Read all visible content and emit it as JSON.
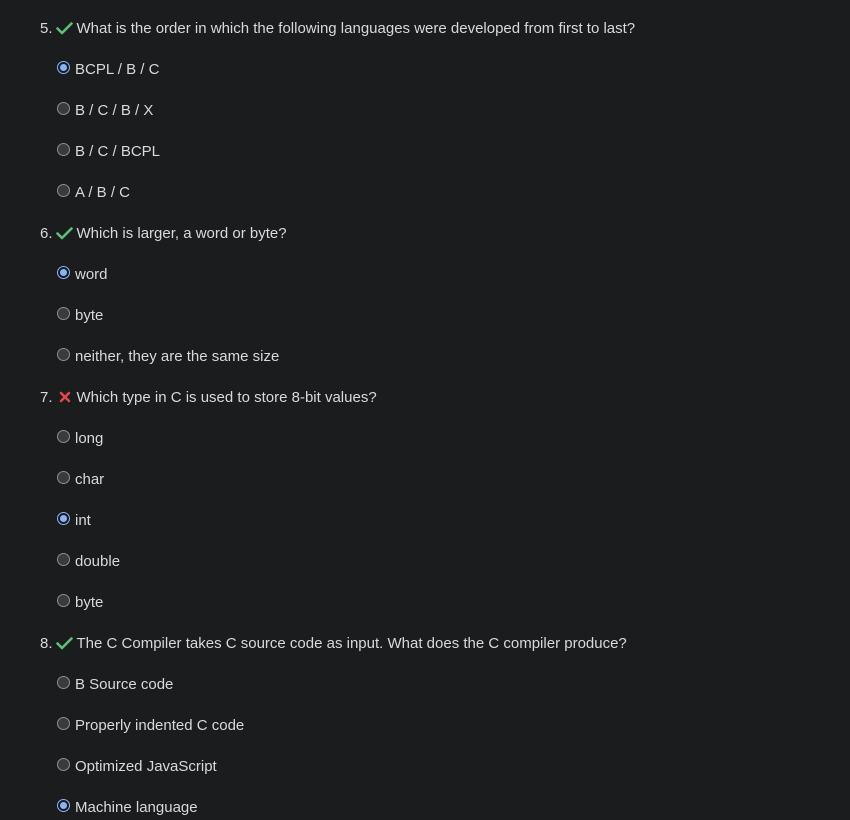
{
  "questions": [
    {
      "number": "5.",
      "status": "correct",
      "text": "What is the order in which the following languages were developed from first to last?",
      "options": [
        {
          "label": "BCPL / B / C",
          "selected": true
        },
        {
          "label": "B / C / B / X",
          "selected": false
        },
        {
          "label": "B / C / BCPL",
          "selected": false
        },
        {
          "label": "A / B / C",
          "selected": false
        }
      ]
    },
    {
      "number": "6.",
      "status": "correct",
      "text": "Which is larger, a word or byte?",
      "options": [
        {
          "label": "word",
          "selected": true
        },
        {
          "label": "byte",
          "selected": false
        },
        {
          "label": "neither, they are the same size",
          "selected": false
        }
      ]
    },
    {
      "number": "7.",
      "status": "incorrect",
      "text": "Which type in C is used to store 8-bit values?",
      "options": [
        {
          "label": "long",
          "selected": false
        },
        {
          "label": "char",
          "selected": false
        },
        {
          "label": "int",
          "selected": true
        },
        {
          "label": "double",
          "selected": false
        },
        {
          "label": "byte",
          "selected": false
        }
      ]
    },
    {
      "number": "8.",
      "status": "correct",
      "text": "The C Compiler takes C source code as input. What does the C compiler produce?",
      "options": [
        {
          "label": "B Source code",
          "selected": false
        },
        {
          "label": "Properly indented C code",
          "selected": false
        },
        {
          "label": "Optimized JavaScript",
          "selected": false
        },
        {
          "label": "Machine language",
          "selected": true
        }
      ]
    }
  ],
  "icons": {
    "correct": "checkmark-icon",
    "incorrect": "cross-icon"
  },
  "colors": {
    "background": "#1b1c1e",
    "text": "#d8d9da",
    "correct": "#5cc07a",
    "incorrect": "#e0464f",
    "radio_selected": "#8ab4f8",
    "radio_unselected_fill": "#3a3b3e"
  }
}
